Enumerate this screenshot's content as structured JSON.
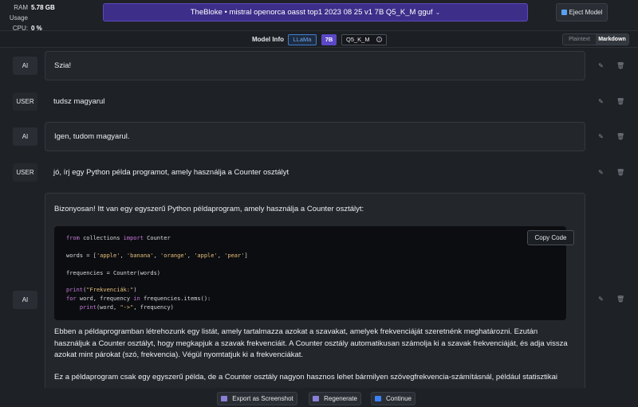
{
  "stats": {
    "ram_label": "RAM Usage",
    "ram_value": "5.78 GB",
    "cpu_label": "CPU:",
    "cpu_value": "0 %"
  },
  "model": {
    "name": "TheBloke • mistral openorca oasst top1 2023 08 25 v1 7B Q5_K_M gguf",
    "eject_label": "Eject Model"
  },
  "info": {
    "label": "Model Info",
    "arch": "LLaMa",
    "size": "7B",
    "quant": "Q5_K_M"
  },
  "format_toggle": {
    "plaintext": "Plaintext",
    "markdown": "Markdown"
  },
  "messages": [
    {
      "role": "AI",
      "text": "Szia!"
    },
    {
      "role": "USER",
      "text": "tudsz magyarul"
    },
    {
      "role": "AI",
      "text": "Igen, tudom magyarul."
    },
    {
      "role": "USER",
      "text": "jó, írj egy Python példa programot, amely használja a Counter osztályt"
    },
    {
      "role": "AI",
      "intro": "Bizonyosan! Itt van egy egyszerű Python példaprogram, amely használja a Counter osztályt:",
      "copy_label": "Copy Code",
      "para1": "Ebben a példaprogramban létrehozunk egy listát, amely tartalmazza azokat a szavakat, amelyek frekvenciáját szeretnénk meghatározni. Ezután használjuk a Counter osztályt, hogy megkapjuk a szavak frekvenciáit. A Counter osztály automatikusan számolja ki a szavak frekvenciáját, és adja vissza azokat mint párokat (szó, frekvencia). Végül nyomtatjuk ki a frekvenciákat.",
      "para2": "Ez a példaprogram csak egy egyszerű példa, de a Counter osztály nagyon hasznos lehet bármilyen szövegfrekvencia-számításnál, például statisztikai"
    }
  ],
  "code": {
    "l1_kw1": "from",
    "l1_mid": " collections ",
    "l1_kw2": "import",
    "l1_end": " Counter",
    "l2_a": "words = [",
    "w1": "'apple'",
    "w2": "'banana'",
    "w3": "'orange'",
    "w4": "'apple'",
    "w5": "'pear'",
    "sep": ", ",
    "l2_end": "]",
    "l3": "frequencies = Counter(words)",
    "l4_kw": "print",
    "l4_a": "(",
    "l4_str": "\"Frekvenciák:\"",
    "l4_b": ")",
    "l5_kw1": "for",
    "l5_a": " word, frequency ",
    "l5_kw2": "in",
    "l5_b": " frequencies.items():",
    "l6_indent": "    ",
    "l6_kw": "print",
    "l6_a": "(word, ",
    "l6_str": "\"->\"",
    "l6_b": ", frequency)"
  },
  "bottom": {
    "export": "Export as Screenshot",
    "regenerate": "Regenerate",
    "continue": "Continue"
  },
  "colors": {
    "accent": "#3d2e8a",
    "tag_7b": "#5b48c7",
    "llama_blue": "#6aa8f0",
    "keyword": "#c678dd",
    "string": "#e5c07b"
  }
}
